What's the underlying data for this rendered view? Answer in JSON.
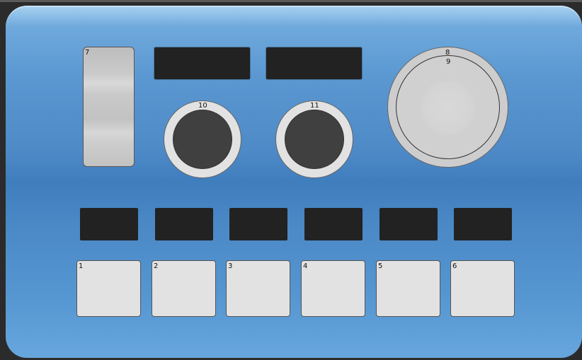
{
  "controller": {
    "fader": {
      "label": "7"
    },
    "knobs": [
      {
        "label": "10"
      },
      {
        "label": "11"
      }
    ],
    "jog_wheel": {
      "label_top": "8",
      "label_inner": "9"
    },
    "pads": [
      {
        "label": "1"
      },
      {
        "label": "2"
      },
      {
        "label": "3"
      },
      {
        "label": "4"
      },
      {
        "label": "5"
      },
      {
        "label": "6"
      }
    ]
  },
  "colors": {
    "panel_blue": "#4a88c6",
    "display_black": "#222222",
    "control_gray": "#e2e2e2",
    "knob_dark": "#404040"
  }
}
